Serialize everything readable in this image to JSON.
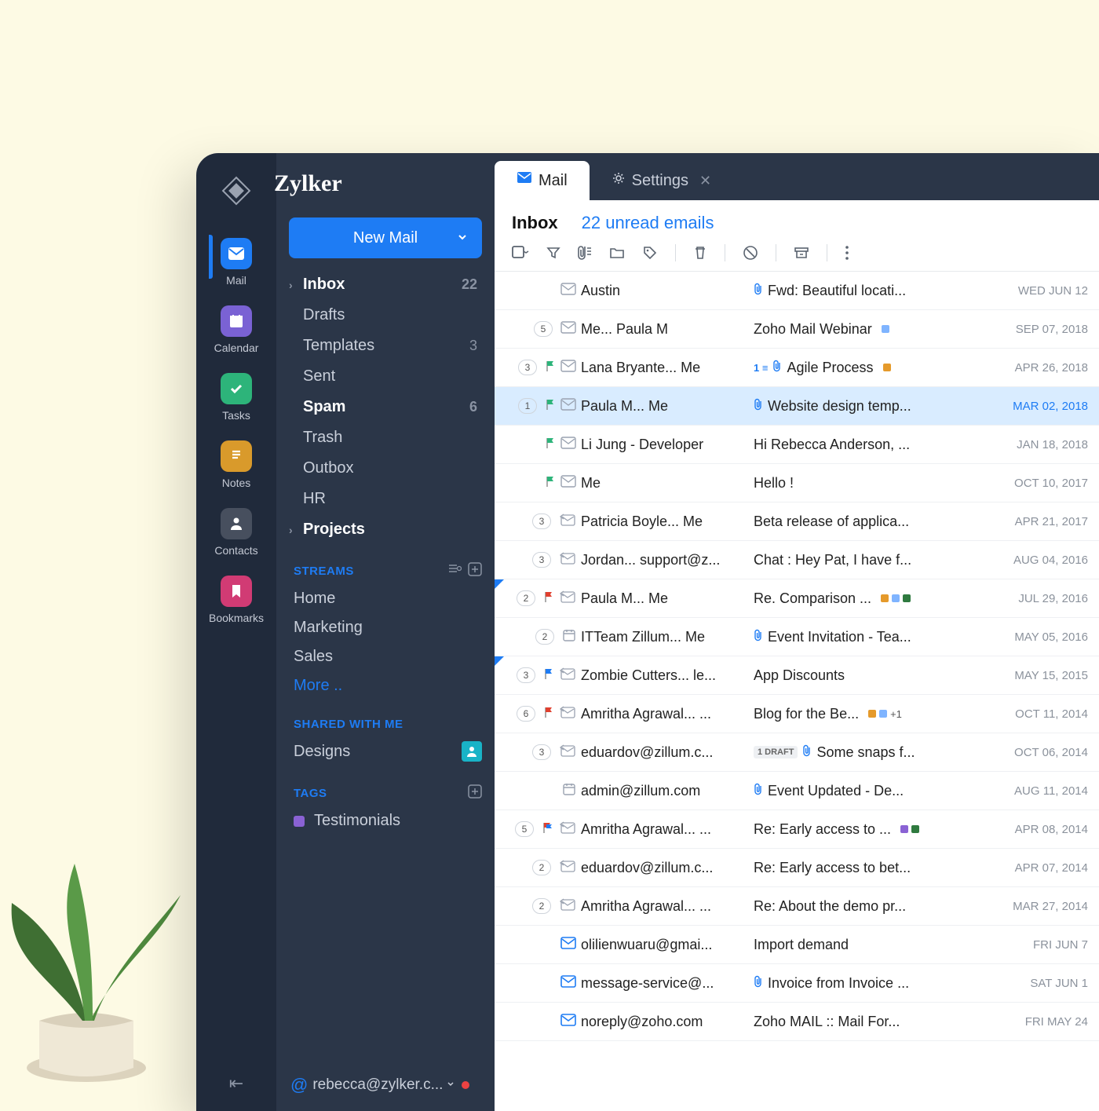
{
  "brand": "Zylker",
  "newMail": "New Mail",
  "rail": [
    {
      "key": "mail",
      "label": "Mail",
      "color": "#1e7cf4",
      "icon": "mail",
      "active": true
    },
    {
      "key": "calendar",
      "label": "Calendar",
      "color": "#7a62d4",
      "icon": "calendar"
    },
    {
      "key": "tasks",
      "label": "Tasks",
      "color": "#2db47a",
      "icon": "check"
    },
    {
      "key": "notes",
      "label": "Notes",
      "color": "#d99a2b",
      "icon": "notes"
    },
    {
      "key": "contacts",
      "label": "Contacts",
      "color": "#474f5e",
      "icon": "person"
    },
    {
      "key": "bookmarks",
      "label": "Bookmarks",
      "color": "#d13b74",
      "icon": "bookmark"
    }
  ],
  "folders": [
    {
      "name": "Inbox",
      "bold": true,
      "count": "22",
      "caret": true
    },
    {
      "name": "Drafts"
    },
    {
      "name": "Templates",
      "count": "3"
    },
    {
      "name": "Sent"
    },
    {
      "name": "Spam",
      "bold": true,
      "count": "6"
    },
    {
      "name": "Trash"
    },
    {
      "name": "Outbox"
    },
    {
      "name": "HR"
    },
    {
      "name": "Projects",
      "bold": true,
      "caret": true
    }
  ],
  "sections": {
    "streams": {
      "title": "STREAMS",
      "items": [
        "Home",
        "Marketing",
        "Sales"
      ],
      "more": "More .."
    },
    "shared": {
      "title": "SHARED WITH ME",
      "items": [
        {
          "label": "Designs",
          "avatar": true
        }
      ]
    },
    "tags": {
      "title": "TAGS",
      "items": [
        {
          "label": "Testimonials",
          "color": "#8a62d4"
        }
      ]
    }
  },
  "account": "rebecca@zylker.c...",
  "tabs": [
    {
      "label": "Mail",
      "icon": "mail",
      "active": true
    },
    {
      "label": "Settings",
      "icon": "gear",
      "closable": true
    }
  ],
  "listHeader": {
    "folder": "Inbox",
    "unread": "22 unread emails"
  },
  "messages": [
    {
      "from": "Austin",
      "subject": "Fwd: Beautiful locati...",
      "date": "WED JUN 12",
      "attach": true,
      "env": "gray"
    },
    {
      "from": "Me... Paula M",
      "subject": "Zoho Mail Webinar",
      "date": "SEP 07, 2018",
      "count": "5",
      "env": "gray",
      "tags": [
        "#7fb4ff"
      ]
    },
    {
      "from": "Lana Bryante... Me",
      "subject": "Agile Process",
      "date": "APR 26, 2018",
      "count": "3",
      "flag": "#2db47a",
      "env": "gray",
      "attach": true,
      "thread": "1",
      "tags": [
        "#e59a2b"
      ]
    },
    {
      "from": "Paula M... Me",
      "subject": "Website design temp...",
      "date": "MAR 02, 2018",
      "count": "1",
      "flag": "#2db47a",
      "env": "gray",
      "attach": true,
      "selected": true,
      "dateHl": true
    },
    {
      "from": "Li Jung - Developer",
      "subject": "Hi Rebecca Anderson, ...",
      "date": "JAN 18, 2018",
      "flag": "#2db47a",
      "env": "gray",
      "indented": true
    },
    {
      "from": "Me",
      "subject": "Hello !",
      "date": "OCT 10, 2017",
      "flag": "#2db47a",
      "env": "gray",
      "indented": true
    },
    {
      "from": "Patricia Boyle... Me",
      "subject": "Beta release of applica...",
      "date": "APR 21, 2017",
      "count": "3",
      "env": "reply"
    },
    {
      "from": "Jordan... support@z...",
      "subject": "Chat : Hey Pat, I have f...",
      "date": "AUG 04, 2016",
      "count": "3",
      "env": "reply"
    },
    {
      "from": "Paula M... Me",
      "subject": "Re. Comparison ...",
      "date": "JUL 29, 2016",
      "count": "2",
      "flag": "#e0402f",
      "env": "reply",
      "tri": true,
      "tags": [
        "#e59a2b",
        "#7fb4ff",
        "#2f7a3f"
      ]
    },
    {
      "from": "ITTeam Zillum... Me",
      "subject": "Event Invitation - Tea...",
      "date": "MAY 05, 2016",
      "count": "2",
      "env": "cal",
      "attach": true
    },
    {
      "from": "Zombie Cutters... le...",
      "subject": "App Discounts",
      "date": "MAY 15, 2015",
      "count": "3",
      "flag": "#1e7cf4",
      "env": "reply",
      "tri": true
    },
    {
      "from": "Amritha Agrawal... ...",
      "subject": "Blog for the Be...",
      "date": "OCT 11, 2014",
      "count": "6",
      "flag": "#e0402f",
      "env": "reply",
      "tags": [
        "#e59a2b",
        "#7fb4ff"
      ],
      "plus": "+1"
    },
    {
      "from": "eduardov@zillum.c...",
      "subject": "Some snaps f...",
      "date": "OCT 06, 2014",
      "count": "3",
      "env": "reply",
      "attach": true,
      "draft": "1 DRAFT"
    },
    {
      "from": "admin@zillum.com",
      "subject": "Event Updated - De...",
      "date": "AUG 11, 2014",
      "env": "cal",
      "attach": true
    },
    {
      "from": "Amritha Agrawal... ...",
      "subject": "Re: Early access to ...",
      "date": "APR 08, 2014",
      "count": "5",
      "flag": "multi",
      "env": "reply",
      "tags": [
        "#8a62d4",
        "#2f7a3f"
      ]
    },
    {
      "from": "eduardov@zillum.c...",
      "subject": "Re: Early access to bet...",
      "date": "APR 07, 2014",
      "count": "2",
      "env": "reply"
    },
    {
      "from": "Amritha Agrawal... ...",
      "subject": "Re: About the demo pr...",
      "date": "MAR 27, 2014",
      "count": "2",
      "env": "reply"
    },
    {
      "from": "olilienwuaru@gmai...",
      "subject": "Import demand",
      "date": "FRI JUN 7",
      "env": "blue"
    },
    {
      "from": "message-service@...",
      "subject": "Invoice from Invoice ...",
      "date": "SAT JUN 1",
      "env": "blue",
      "attach": true
    },
    {
      "from": "noreply@zoho.com",
      "subject": "Zoho MAIL :: Mail For...",
      "date": "FRI MAY 24",
      "env": "blue"
    }
  ]
}
